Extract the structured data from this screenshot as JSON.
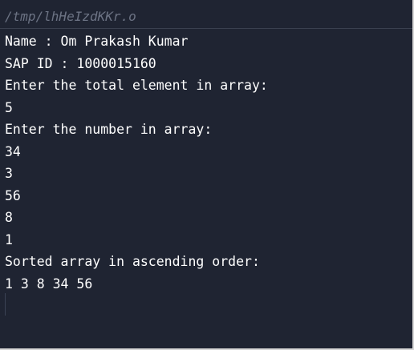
{
  "terminal": {
    "file_path": "/tmp/lhHeIzdKKr.o",
    "lines": [
      "Name : Om Prakash Kumar",
      "SAP ID : 1000015160",
      "Enter the total element in array:",
      "5",
      "Enter the number in array:",
      "34",
      "3",
      "56",
      "8",
      "1",
      "Sorted array in ascending order:",
      "1 3 8 34 56"
    ]
  }
}
